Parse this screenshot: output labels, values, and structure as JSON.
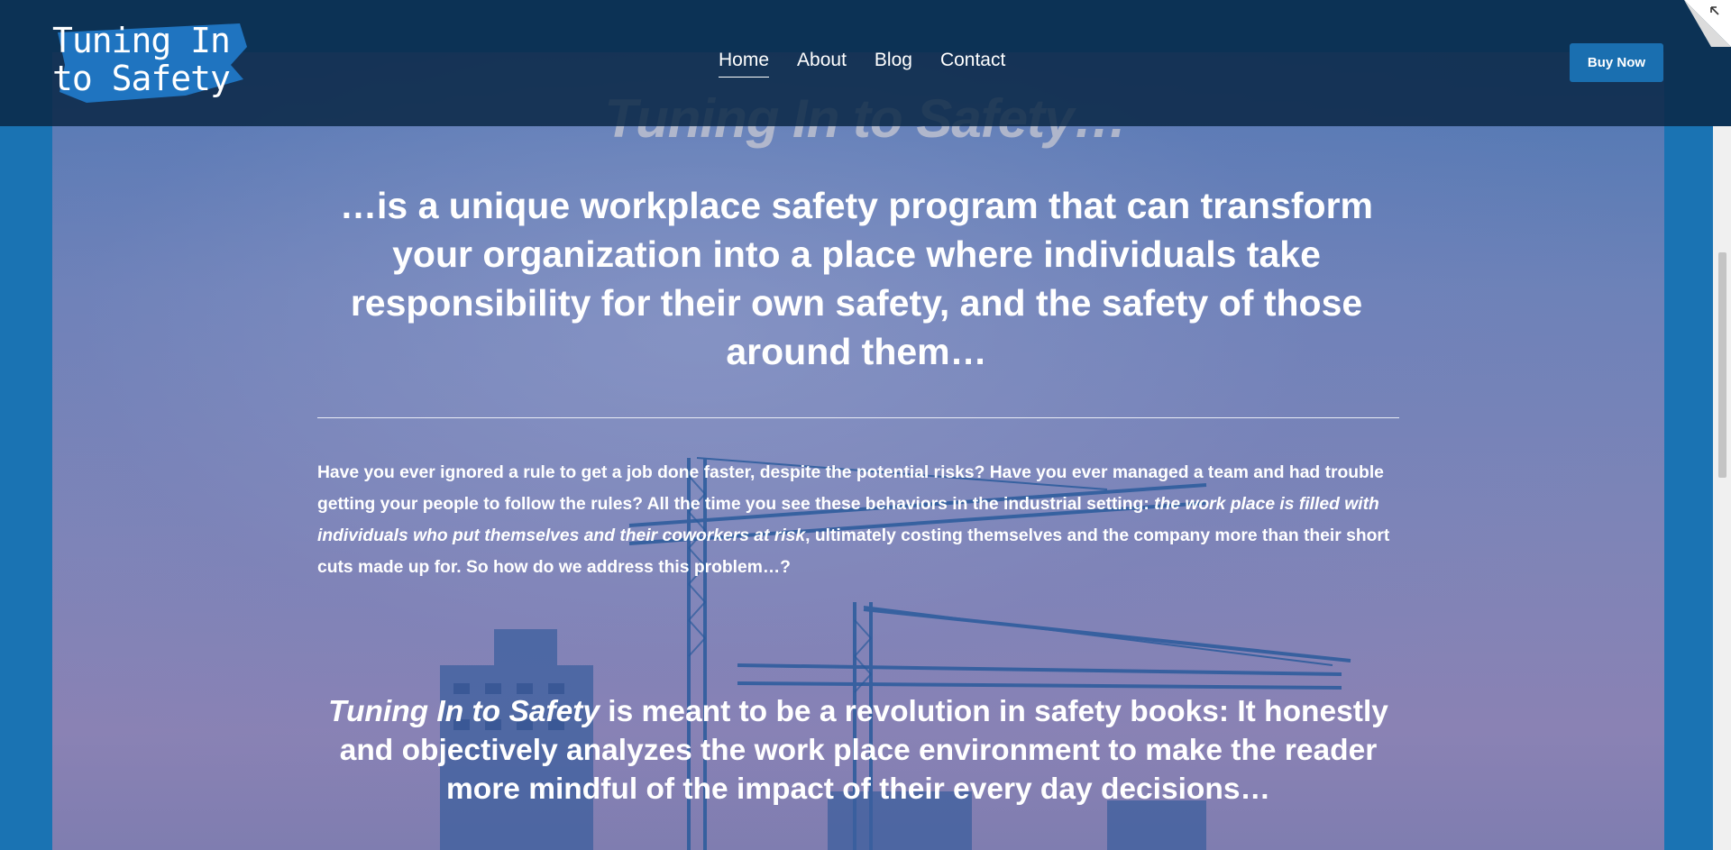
{
  "logo": {
    "line1": "Tuning In",
    "line2": "to Safety"
  },
  "nav": [
    {
      "label": "Home",
      "active": true
    },
    {
      "label": "About",
      "active": false
    },
    {
      "label": "Blog",
      "active": false
    },
    {
      "label": "Contact",
      "active": false
    }
  ],
  "buy_button": "Buy Now",
  "hero": {
    "title": "Tuning In to Safety…",
    "subtitle": "…is a unique workplace safety program that can transform your organization into a place where individuals take responsibility for their own safety, and the safety of those around them…",
    "body_part1": "Have you ever ignored a rule to get a job done faster, despite the potential risks? Have you ever managed a team and had trouble getting your people to follow the rules? All the time you see these behaviors in the industrial setting: ",
    "body_emphasis": "the work place is filled with individuals who put themselves and their coworkers at risk",
    "body_part2": ", ultimately costing themselves and the company more than their short cuts made up for. So how do we address this problem…?",
    "quote_emphasis": "Tuning In to Safety",
    "quote_rest": " is meant to be a revolution in safety books: It honestly and objectively analyzes the work place environment to make the reader more mindful of the impact of their every day decisions…"
  },
  "colors": {
    "header_bg": "#0a2846",
    "page_bg": "#1a73b3",
    "button_bg": "#1a6fb0",
    "logo_brush": "#1f74c0"
  }
}
